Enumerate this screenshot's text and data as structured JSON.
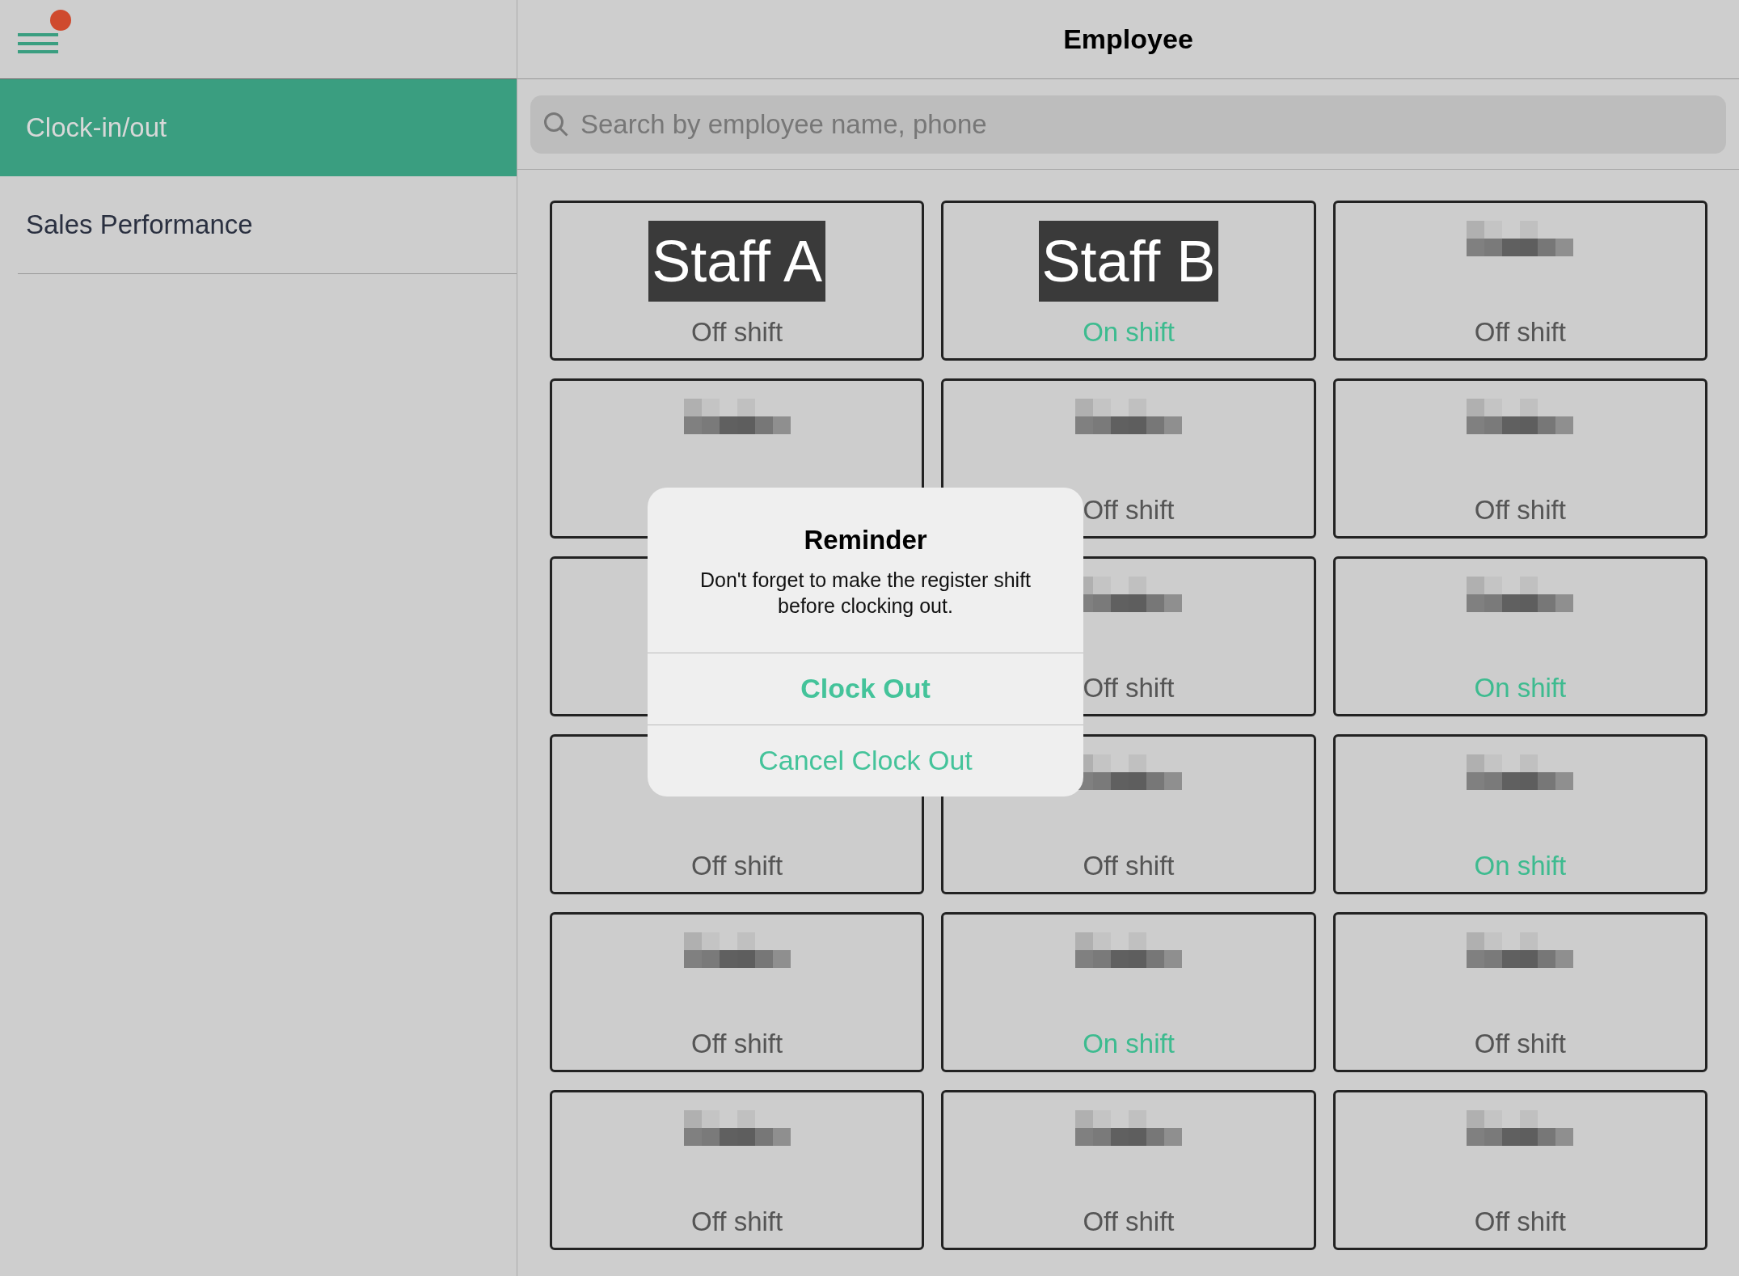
{
  "sidebar": {
    "menu_badge": true,
    "items": [
      {
        "label": "Clock-in/out",
        "selected": true
      },
      {
        "label": "Sales Performance",
        "selected": false
      }
    ]
  },
  "header": {
    "title": "Employee"
  },
  "search": {
    "placeholder": "Search by employee name, phone"
  },
  "employees": [
    {
      "kind": "label",
      "name": "Staff A",
      "status": "Off shift",
      "on_shift": false
    },
    {
      "kind": "label",
      "name": "Staff B",
      "status": "On shift",
      "on_shift": true
    },
    {
      "kind": "redacted",
      "status": "Off shift",
      "on_shift": false
    },
    {
      "kind": "redacted"
    },
    {
      "kind": "redacted",
      "status": "Off shift",
      "on_shift": false
    },
    {
      "kind": "redacted",
      "status": "Off shift",
      "on_shift": false
    },
    {
      "kind": "none"
    },
    {
      "kind": "redacted",
      "status": "Off shift",
      "on_shift": false
    },
    {
      "kind": "redacted",
      "status": "On shift",
      "on_shift": true
    },
    {
      "kind": "none",
      "status": "Off shift",
      "on_shift": false
    },
    {
      "kind": "redacted",
      "status": "Off shift",
      "on_shift": false
    },
    {
      "kind": "redacted",
      "status": "On shift",
      "on_shift": true
    },
    {
      "kind": "redacted",
      "status": "Off shift",
      "on_shift": false
    },
    {
      "kind": "redacted",
      "status": "On shift",
      "on_shift": true
    },
    {
      "kind": "redacted",
      "status": "Off shift",
      "on_shift": false
    },
    {
      "kind": "redacted",
      "status": "Off shift",
      "on_shift": false
    },
    {
      "kind": "redacted",
      "status": "Off shift",
      "on_shift": false
    },
    {
      "kind": "redacted",
      "status": "Off shift",
      "on_shift": false
    }
  ],
  "dialog": {
    "title": "Reminder",
    "message": "Don't forget to make the register shift before clocking out.",
    "buttons": [
      {
        "label": "Clock Out",
        "primary": true
      },
      {
        "label": "Cancel Clock Out",
        "primary": false
      }
    ]
  }
}
